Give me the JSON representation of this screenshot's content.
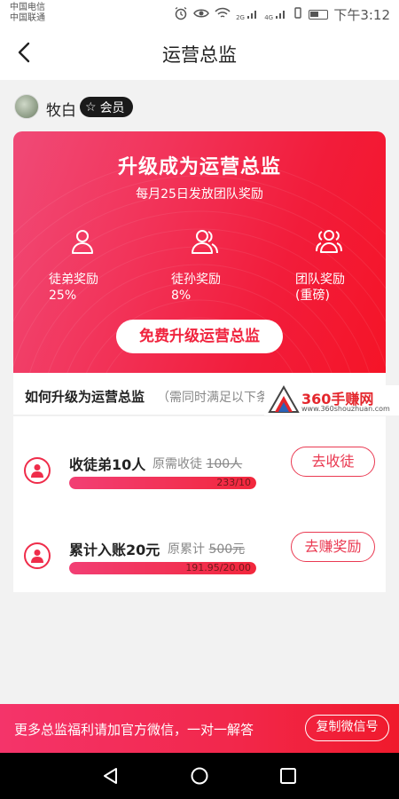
{
  "status_bar": {
    "carrier_1": "中国电信",
    "carrier_2": "中国联通",
    "time": "下午3:12",
    "icons": [
      "alarm-icon",
      "eye-icon",
      "wifi-icon",
      "signal-icon",
      "mute-icon",
      "battery-icon"
    ],
    "network_labels": [
      "2G",
      "4G"
    ]
  },
  "header": {
    "title": "运营总监",
    "back_icon": "back-arrow-icon"
  },
  "user": {
    "name": "牧白",
    "badge": "会员",
    "badge_icon": "star-outline-icon"
  },
  "promo": {
    "title": "升级成为运营总监",
    "subtitle": "每月25日发放团队奖励",
    "benefits": [
      {
        "icon": "person-icon",
        "label": "徒弟奖励",
        "value": "25%"
      },
      {
        "icon": "two-persons-icon",
        "label": "徒孙奖励",
        "value": "8%"
      },
      {
        "icon": "group-icon",
        "label": "团队奖励",
        "value": "(重磅)"
      }
    ],
    "button": "免费升级运营总监",
    "colors": {
      "start": "#f04a77",
      "end": "#f51427"
    }
  },
  "howto": {
    "title": "如何升级为运营总监",
    "subtitle": "（需同时满足以下条"
  },
  "watermark": {
    "text": "360手赚网",
    "url": "www.360shouzhuan.com"
  },
  "tasks": [
    {
      "title": "收徒弟10人",
      "req_prefix": "原需收徒",
      "req_old": "100人",
      "progress_text": "233/10",
      "progress": 1.0,
      "button": "去收徒"
    },
    {
      "title": "累计入账20元",
      "req_prefix": "原累计",
      "req_old": "500元",
      "progress_text": "191.95/20.00",
      "progress": 1.0,
      "button": "去赚奖励"
    }
  ],
  "footer": {
    "text": "更多总监福利请加官方微信，一对一解答",
    "button": "复制微信号"
  },
  "system_nav": [
    "back-triangle-icon",
    "home-circle-icon",
    "recents-square-icon"
  ],
  "accent_color": "#ef2c4a"
}
